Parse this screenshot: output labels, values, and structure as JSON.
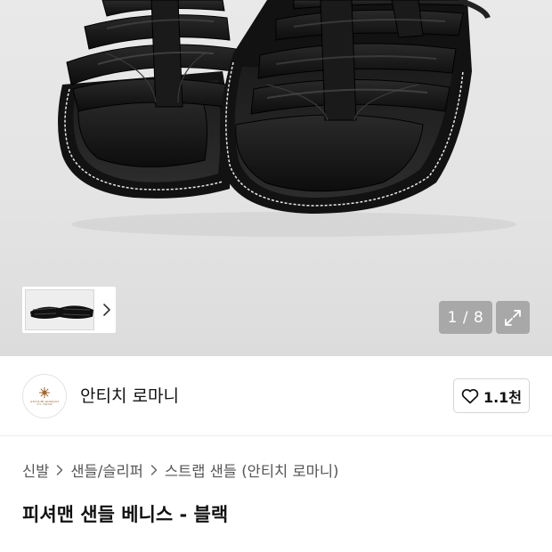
{
  "gallery": {
    "image_alt": "Black fisherman strap sandals",
    "page_counter": "1 / 8",
    "icons": {
      "thumbnail_next": "chevron-right-icon",
      "expand": "expand-arrows-icon"
    }
  },
  "brand": {
    "name": "안티치 로마니",
    "logo_text": "ANTICHI ROMANI",
    "logo_subtext": "1972 · FIRENZE",
    "like_count": "1.1천",
    "icons": {
      "like": "heart-outline-icon"
    }
  },
  "breadcrumb": [
    {
      "label": "신발"
    },
    {
      "label": "샌들/슬리퍼"
    },
    {
      "label": "스트랩 샌들 (안티치 로마니)"
    }
  ],
  "product": {
    "title": "피셔맨 샌들 베니스 - 블랙"
  },
  "colors": {
    "gallery_bg": "#e6e6e6",
    "overlay_badge": "#a8a8a8",
    "text_primary": "#111111",
    "text_secondary": "#555555"
  }
}
